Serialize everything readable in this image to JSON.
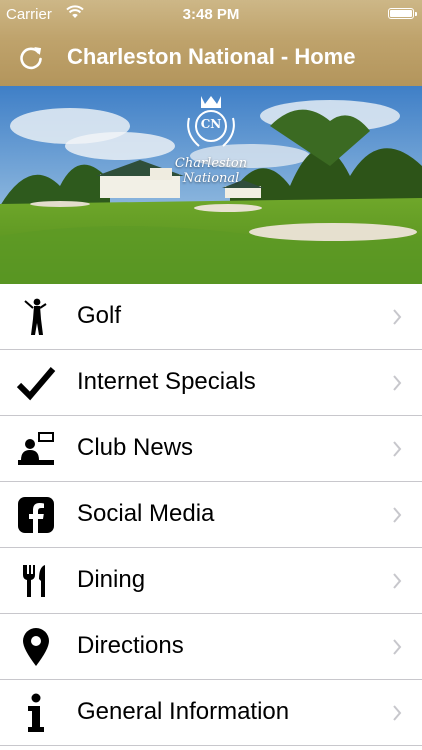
{
  "status_bar": {
    "carrier": "Carrier",
    "time": "3:48 PM",
    "battery_level": 1.0,
    "icons": [
      "wifi-icon",
      "battery-icon"
    ]
  },
  "nav": {
    "title": "Charleston National - Home",
    "refresh_icon": "refresh-icon"
  },
  "hero": {
    "logo_monogram": "CN",
    "logo_script": "Charleston National"
  },
  "colors": {
    "header_gold": "#bfa36c",
    "separator": "#c8c7cc",
    "chevron": "#c7c7cc"
  },
  "menu": {
    "items": [
      {
        "label": "Golf",
        "icon": "golfer-icon"
      },
      {
        "label": "Internet Specials",
        "icon": "checkmark-icon"
      },
      {
        "label": "Club News",
        "icon": "news-icon"
      },
      {
        "label": "Social Media",
        "icon": "facebook-icon"
      },
      {
        "label": "Dining",
        "icon": "fork-knife-icon"
      },
      {
        "label": "Directions",
        "icon": "location-pin-icon"
      },
      {
        "label": "General Information",
        "icon": "info-icon"
      }
    ]
  }
}
